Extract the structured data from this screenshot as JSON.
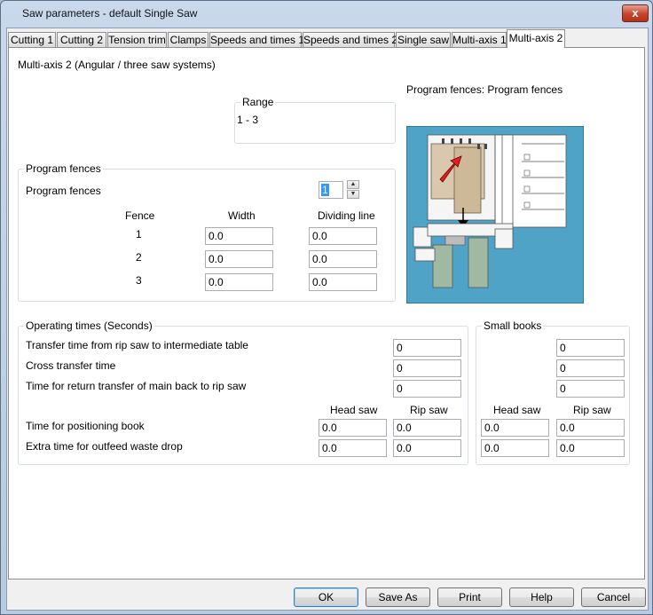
{
  "window": {
    "title": "Saw parameters - default Single Saw",
    "close_glyph": "x"
  },
  "tabs": [
    {
      "label": "Cutting 1"
    },
    {
      "label": "Cutting 2"
    },
    {
      "label": "Tension trim"
    },
    {
      "label": "Clamps"
    },
    {
      "label": "Speeds and times 1"
    },
    {
      "label": "Speeds and times 2"
    },
    {
      "label": "Single saw"
    },
    {
      "label": "Multi-axis 1"
    },
    {
      "label": "Multi-axis 2",
      "active": true
    }
  ],
  "panel": {
    "heading": "Multi-axis 2 (Angular / three saw systems)",
    "range": {
      "title": "Range",
      "value": "1 - 3"
    },
    "image_caption": "Program fences: Program fences",
    "program_fences": {
      "group_title": "Program fences",
      "label": "Program fences",
      "spin_value": "1",
      "col_fence": "Fence",
      "col_width": "Width",
      "col_dividing": "Dividing line",
      "rows": [
        {
          "fence": "1",
          "width": "0.0",
          "dividing": "0.0"
        },
        {
          "fence": "2",
          "width": "0.0",
          "dividing": "0.0"
        },
        {
          "fence": "3",
          "width": "0.0",
          "dividing": "0.0"
        }
      ]
    },
    "operating_times": {
      "group_title": "Operating times (Seconds)",
      "rows": [
        {
          "label": "Transfer time from rip saw to intermediate table",
          "value": "0"
        },
        {
          "label": "Cross transfer time",
          "value": "0"
        },
        {
          "label": "Time for return transfer of main back to rip saw",
          "value": "0"
        }
      ],
      "col_head": "Head saw",
      "col_rip": "Rip saw",
      "pair_rows": [
        {
          "label": "Time for positioning book",
          "head": "0.0",
          "rip": "0.0"
        },
        {
          "label": "Extra time for outfeed waste drop",
          "head": "0.0",
          "rip": "0.0"
        }
      ]
    },
    "small_books": {
      "group_title": "Small books",
      "values": [
        "0",
        "0",
        "0"
      ],
      "col_head": "Head saw",
      "col_rip": "Rip saw",
      "pair_rows": [
        {
          "head": "0.0",
          "rip": "0.0"
        },
        {
          "head": "0.0",
          "rip": "0.0"
        }
      ]
    }
  },
  "buttons": {
    "ok": "OK",
    "save_as": "Save As",
    "print": "Print",
    "help": "Help",
    "cancel": "Cancel"
  },
  "colors": {
    "diagram_bg": "#4fa3c7",
    "arrow": "#e02020"
  }
}
